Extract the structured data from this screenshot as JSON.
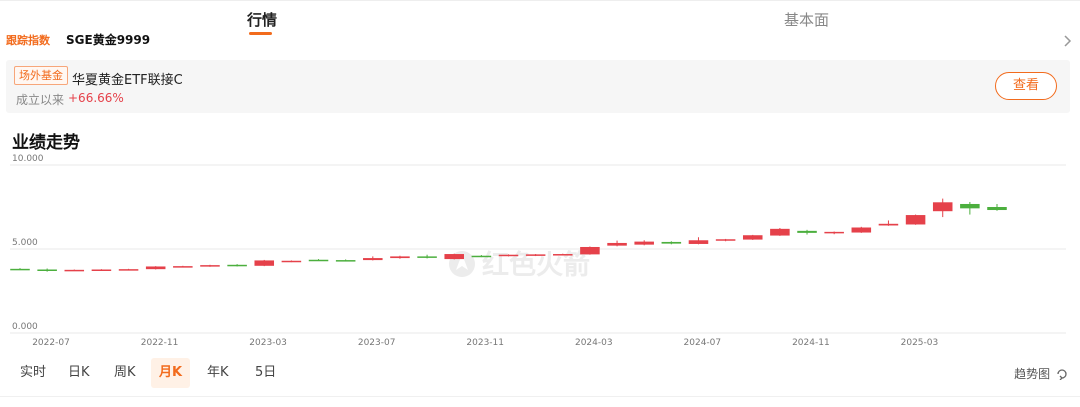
{
  "tabs": [
    {
      "label": "行情",
      "active": true
    },
    {
      "label": "基本面",
      "active": false
    }
  ],
  "tracking": {
    "label": "跟踪指数",
    "value": "SGE黄金9999"
  },
  "fund": {
    "tag": "场外基金",
    "name": "华夏黄金ETF联接C",
    "since_label": "成立以来",
    "since_value": "+66.66%",
    "view_label": "查看"
  },
  "section_title": "业绩走势",
  "watermark": "红色火箭",
  "colors": {
    "up": "#e5414a",
    "down": "#4caf3e",
    "accent": "#f26b1d",
    "grid": "#e8e8e8"
  },
  "periods": [
    {
      "label": "实时",
      "active": false
    },
    {
      "label": "日K",
      "active": false
    },
    {
      "label": "周K",
      "active": false
    },
    {
      "label": "月K",
      "active": true
    },
    {
      "label": "年K",
      "active": false
    },
    {
      "label": "5日",
      "active": false
    }
  ],
  "trend_toggle_label": "趋势图",
  "chart_data": {
    "type": "candlestick",
    "ylim": [
      0,
      10
    ],
    "y_ticks": [
      "0.000",
      "5.000",
      "10.000"
    ],
    "x_ticks": [
      "2022-07",
      "2022-11",
      "2023-03",
      "2023-07",
      "2023-11",
      "2024-03",
      "2024-07",
      "2024-11",
      "2025-03"
    ],
    "candles": [
      {
        "o": 3.82,
        "h": 3.86,
        "l": 3.76,
        "c": 3.8
      },
      {
        "o": 3.78,
        "h": 3.84,
        "l": 3.65,
        "c": 3.72
      },
      {
        "o": 3.72,
        "h": 3.78,
        "l": 3.7,
        "c": 3.76
      },
      {
        "o": 3.74,
        "h": 3.8,
        "l": 3.72,
        "c": 3.78
      },
      {
        "o": 3.76,
        "h": 3.82,
        "l": 3.74,
        "c": 3.8
      },
      {
        "o": 3.8,
        "h": 3.98,
        "l": 3.78,
        "c": 3.96
      },
      {
        "o": 3.92,
        "h": 4.0,
        "l": 3.9,
        "c": 3.98
      },
      {
        "o": 3.96,
        "h": 4.06,
        "l": 3.94,
        "c": 4.04
      },
      {
        "o": 4.06,
        "h": 4.1,
        "l": 3.96,
        "c": 4.0
      },
      {
        "o": 4.0,
        "h": 4.35,
        "l": 3.98,
        "c": 4.32
      },
      {
        "o": 4.25,
        "h": 4.32,
        "l": 4.22,
        "c": 4.3
      },
      {
        "o": 4.36,
        "h": 4.4,
        "l": 4.32,
        "c": 4.34
      },
      {
        "o": 4.34,
        "h": 4.38,
        "l": 4.3,
        "c": 4.32
      },
      {
        "o": 4.34,
        "h": 4.56,
        "l": 4.32,
        "c": 4.46
      },
      {
        "o": 4.46,
        "h": 4.6,
        "l": 4.42,
        "c": 4.56
      },
      {
        "o": 4.56,
        "h": 4.66,
        "l": 4.44,
        "c": 4.5
      },
      {
        "o": 4.4,
        "h": 4.72,
        "l": 4.38,
        "c": 4.7
      },
      {
        "o": 4.6,
        "h": 4.64,
        "l": 4.52,
        "c": 4.58
      },
      {
        "o": 4.58,
        "h": 4.68,
        "l": 4.56,
        "c": 4.66
      },
      {
        "o": 4.6,
        "h": 4.7,
        "l": 4.58,
        "c": 4.68
      },
      {
        "o": 4.64,
        "h": 4.72,
        "l": 4.62,
        "c": 4.7
      },
      {
        "o": 4.68,
        "h": 5.15,
        "l": 4.66,
        "c": 5.12
      },
      {
        "o": 5.2,
        "h": 5.5,
        "l": 5.16,
        "c": 5.36
      },
      {
        "o": 5.26,
        "h": 5.52,
        "l": 5.22,
        "c": 5.44
      },
      {
        "o": 5.42,
        "h": 5.46,
        "l": 5.28,
        "c": 5.32
      },
      {
        "o": 5.3,
        "h": 5.7,
        "l": 5.28,
        "c": 5.52
      },
      {
        "o": 5.56,
        "h": 5.6,
        "l": 5.46,
        "c": 5.58
      },
      {
        "o": 5.56,
        "h": 5.84,
        "l": 5.54,
        "c": 5.82
      },
      {
        "o": 5.8,
        "h": 6.25,
        "l": 5.78,
        "c": 6.2
      },
      {
        "o": 6.08,
        "h": 6.14,
        "l": 5.86,
        "c": 5.96
      },
      {
        "o": 5.94,
        "h": 6.04,
        "l": 5.88,
        "c": 6.02
      },
      {
        "o": 5.98,
        "h": 6.32,
        "l": 5.96,
        "c": 6.28
      },
      {
        "o": 6.4,
        "h": 6.7,
        "l": 6.38,
        "c": 6.5
      },
      {
        "o": 6.46,
        "h": 7.05,
        "l": 6.44,
        "c": 7.02
      },
      {
        "o": 7.25,
        "h": 8.0,
        "l": 6.9,
        "c": 7.78
      },
      {
        "o": 7.68,
        "h": 7.8,
        "l": 7.05,
        "c": 7.42
      },
      {
        "o": 7.5,
        "h": 7.68,
        "l": 7.28,
        "c": 7.32
      }
    ]
  }
}
